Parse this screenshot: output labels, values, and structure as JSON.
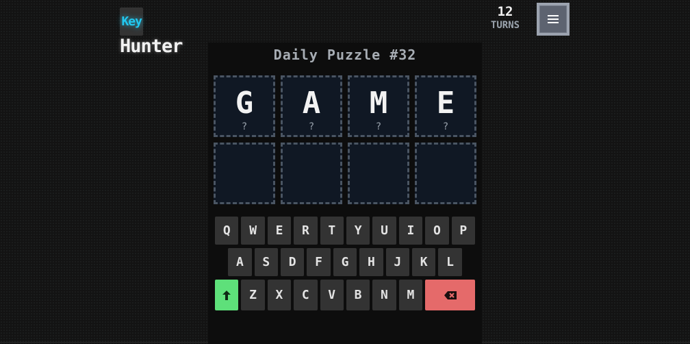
{
  "header": {
    "logo_part1": "Key",
    "logo_part2": "Hunter",
    "turns_count": "12",
    "turns_label": "TURNS",
    "menu_icon": "hamburger-icon"
  },
  "puzzle": {
    "title": "Daily Puzzle #32"
  },
  "board": {
    "rows": [
      [
        {
          "letter": "G",
          "hint": "?"
        },
        {
          "letter": "A",
          "hint": "?"
        },
        {
          "letter": "M",
          "hint": "?"
        },
        {
          "letter": "E",
          "hint": "?"
        }
      ],
      [
        {
          "letter": "",
          "hint": ""
        },
        {
          "letter": "",
          "hint": ""
        },
        {
          "letter": "",
          "hint": ""
        },
        {
          "letter": "",
          "hint": ""
        }
      ]
    ]
  },
  "keyboard": {
    "row1": [
      "Q",
      "W",
      "E",
      "R",
      "T",
      "Y",
      "U",
      "I",
      "O",
      "P"
    ],
    "row2": [
      "A",
      "S",
      "D",
      "F",
      "G",
      "H",
      "J",
      "K",
      "L"
    ],
    "row3": [
      "Z",
      "X",
      "C",
      "V",
      "B",
      "N",
      "M"
    ],
    "enter_icon": "arrow-up-icon",
    "delete_icon": "backspace-icon"
  },
  "colors": {
    "logo_accent": "#22c8f0",
    "enter_key": "#5ee07a",
    "delete_key": "#e56a6a",
    "tile_border": "#4a5563",
    "key_background": "#333333"
  }
}
